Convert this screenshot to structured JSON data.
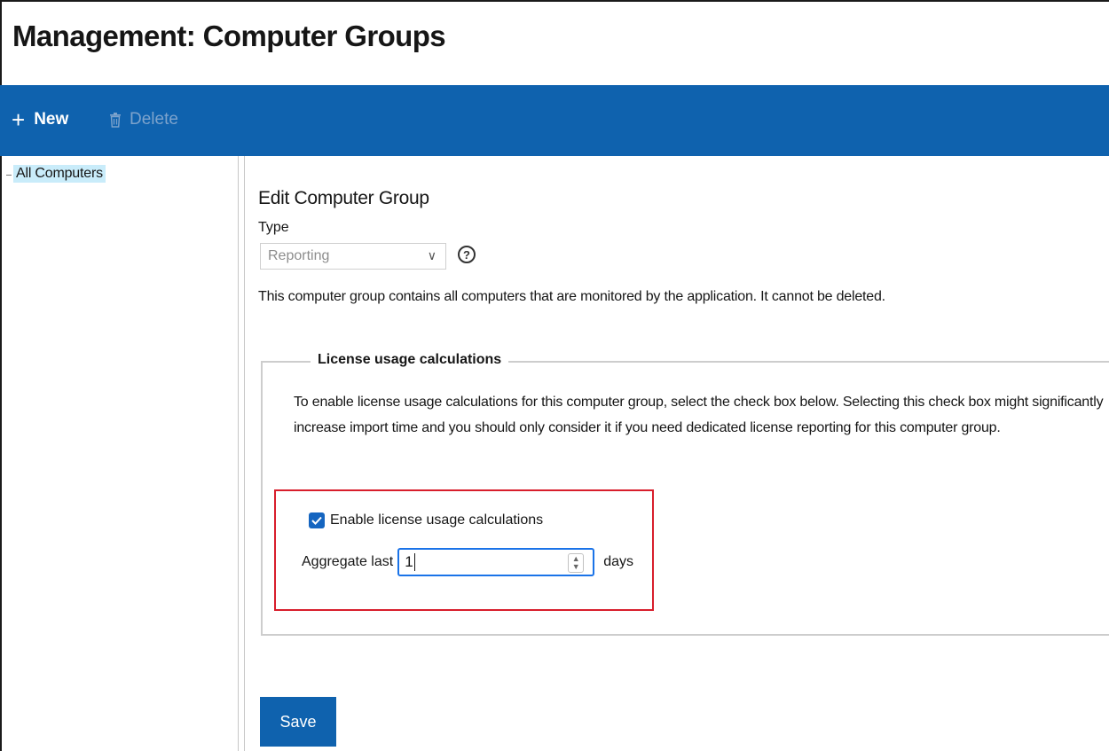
{
  "header": {
    "title": "Management: Computer Groups"
  },
  "toolbar": {
    "new_label": "New",
    "delete_label": "Delete",
    "new_icon": "plus-icon",
    "delete_icon": "trash-icon",
    "background_color": "#0f62ae"
  },
  "tree": {
    "items": [
      {
        "label": "All Computers",
        "selected": true
      }
    ]
  },
  "form": {
    "title": "Edit Computer Group",
    "type_label": "Type",
    "type_value": "Reporting",
    "help_icon": "question-circle-icon",
    "description": "This computer group contains all computers that are monitored by the application. It cannot be deleted.",
    "license": {
      "legend": "License usage calculations",
      "text": "To enable license usage calculations for this computer group, select the check box below. Selecting this check box might significantly increase import time and you should only consider it if you need dedicated license reporting for this computer group.",
      "checkbox_label": "Enable license usage calculations",
      "checkbox_checked": true,
      "aggregate_label": "Aggregate last",
      "aggregate_value": "1",
      "aggregate_unit": "days"
    },
    "save_label": "Save"
  },
  "colors": {
    "accent": "#0f62ae",
    "highlight_border": "#d81e2c",
    "tree_selected": "#c9ecfa"
  }
}
